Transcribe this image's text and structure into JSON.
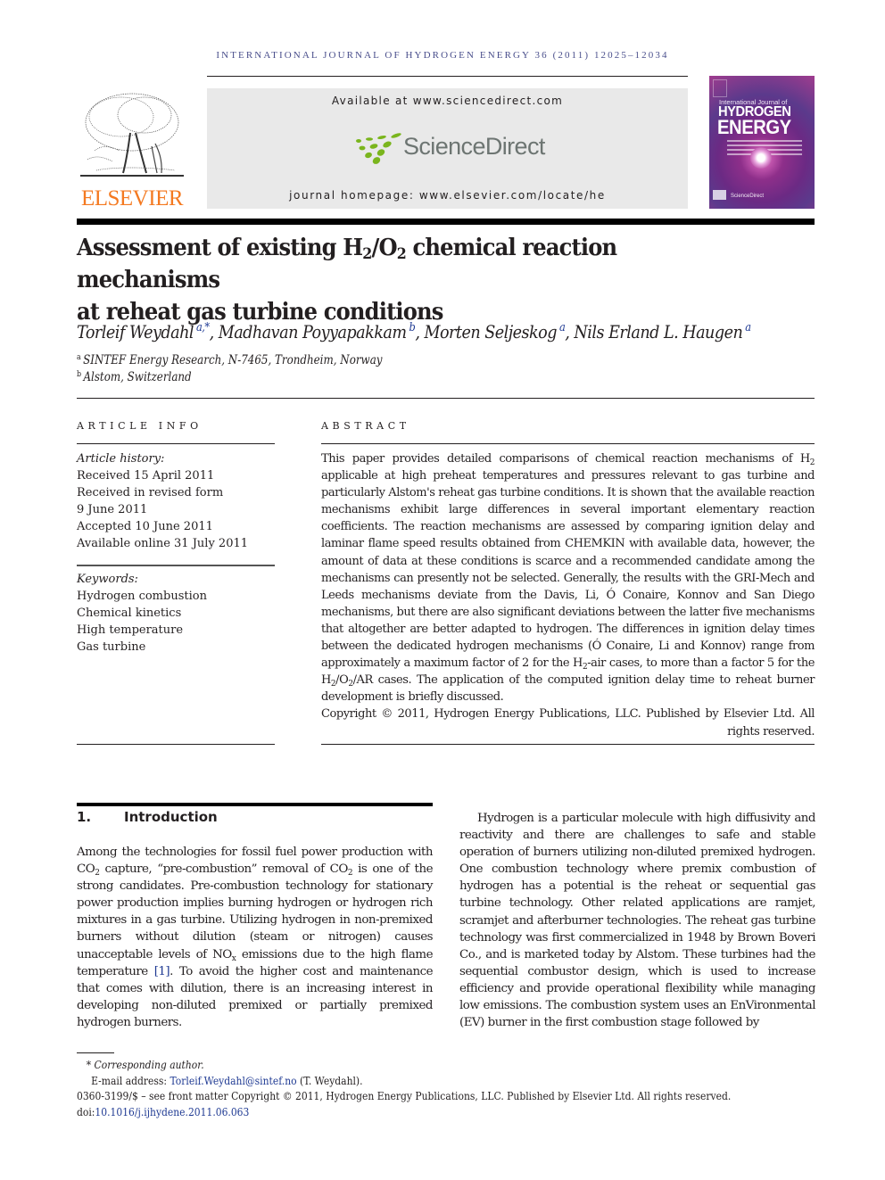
{
  "running_head": "INTERNATIONAL JOURNAL OF HYDROGEN ENERGY 36 (2011) 12025–12034",
  "header": {
    "publisher_logo_text": "ELSEVIER",
    "available_at": "Available at www.sciencedirect.com",
    "sciencedirect_logo_text": "ScienceDirect",
    "journal_homepage": "journal homepage: www.elsevier.com/locate/he",
    "cover": {
      "line1": "International Journal of",
      "line2": "HYDROGEN",
      "line3": "ENERGY",
      "footer": "ScienceDirect"
    },
    "colors": {
      "elsevier_orange": "#f47920",
      "sciencedirect_green": "#7ab51d",
      "sciencedirect_gray": "#6d7572",
      "running_head_blue": "#4a4f8c",
      "link_blue": "#1f3a93"
    }
  },
  "title": {
    "part1": "Assessment of existing H",
    "sub1": "2",
    "part2": "/O",
    "sub2": "2",
    "part3": " chemical reaction mechanisms",
    "line2": "at reheat gas turbine conditions"
  },
  "authors": [
    {
      "name": "Torleif Weydahl",
      "aff": "a,*"
    },
    {
      "name": "Madhavan Poyyapakkam",
      "aff": "b"
    },
    {
      "name": "Morten Seljeskog",
      "aff": "a"
    },
    {
      "name": "Nils Erland L. Haugen",
      "aff": "a"
    }
  ],
  "affiliations": [
    {
      "key": "a",
      "text": "SINTEF Energy Research, N-7465, Trondheim, Norway"
    },
    {
      "key": "b",
      "text": "Alstom, Switzerland"
    }
  ],
  "article_info": {
    "heading": "ARTICLE INFO",
    "history_label": "Article history:",
    "history": [
      "Received 15 April 2011",
      "Received in revised form",
      "9 June 2011",
      "Accepted 10 June 2011",
      "Available online 31 July 2011"
    ],
    "keywords_label": "Keywords:",
    "keywords": [
      "Hydrogen combustion",
      "Chemical kinetics",
      "High temperature",
      "Gas turbine"
    ]
  },
  "abstract": {
    "heading": "ABSTRACT",
    "t1": "This paper provides detailed comparisons of chemical reaction mechanisms of H",
    "t2": " applicable at high preheat temperatures and pressures relevant to gas turbine and particularly Alstom's reheat gas turbine conditions. It is shown that the available reaction mechanisms exhibit large differences in several important elementary reaction coefficients. The reaction mechanisms are assessed by comparing ignition delay and laminar flame speed results obtained from CHEMKIN with available data, however, the amount of data at these conditions is scarce and a recommended candidate among the mechanisms can presently not be selected. Generally, the results with the GRI-Mech and Leeds mechanisms deviate from the Davis, Li, Ó Conaire, Konnov and San Diego mechanisms, but there are also significant deviations between the latter five mechanisms that altogether are better adapted to hydrogen. The differences in ignition delay times between the dedicated hydrogen mechanisms (Ó Conaire, Li and Konnov) range from approximately a maximum factor of 2 for the H",
    "t3": "-air cases, to more than a factor 5 for the H",
    "t4": "/O",
    "t5": "/AR cases. The application of the computed ignition delay time to reheat burner development is briefly discussed.",
    "sub": "2",
    "copyright": "Copyright © 2011, Hydrogen Energy Publications, LLC. Published by Elsevier Ltd. All rights reserved."
  },
  "introduction": {
    "number": "1.",
    "heading": "Introduction",
    "left": {
      "p1a": "Among the technologies for fossil fuel power production with CO",
      "p1b": " capture, “pre-combustion” removal of CO",
      "p1c": " is one of the strong candidates. Pre-combustion technology for stationary power production implies burning hydrogen or hydrogen rich mixtures in a gas turbine. Utilizing hydrogen in non-premixed burners without dilution (steam or nitrogen) causes unacceptable levels of NO",
      "nox_sub": "x",
      "p1d": " emissions due to the high flame temperature ",
      "cite": "[1]",
      "p1e": ". To avoid the higher cost and maintenance that comes with dilution, there is an increasing interest in developing non-diluted premixed or partially premixed hydrogen burners.",
      "sub": "2"
    },
    "right": {
      "p2": "Hydrogen is a particular molecule with high diffusivity and reactivity and there are challenges to safe and stable operation of burners utilizing non-diluted premixed hydrogen. One combustion technology where premix combustion of hydrogen has a potential is the reheat or sequential gas turbine technology. Other related applications are ramjet, scramjet and afterburner technologies. The reheat gas turbine technology was first commercialized in 1948 by Brown Boveri Co., and is marketed today by Alstom. These turbines had the sequential combustor design, which is used to increase efficiency and provide operational flexibility while managing low emissions. The combustion system uses an EnVironmental (EV) burner in the first combustion stage followed by"
    }
  },
  "footnotes": {
    "star": "*",
    "corresponding": "Corresponding author.",
    "email_label": "E-mail address: ",
    "email": "Torleif.Weydahl@sintef.no",
    "email_suffix": " (T. Weydahl).",
    "front_matter": "0360-3199/$ – see front matter Copyright © 2011, Hydrogen Energy Publications, LLC. Published by Elsevier Ltd. All rights reserved.",
    "doi_label": "doi:",
    "doi": "10.1016/j.ijhydene.2011.06.063"
  }
}
